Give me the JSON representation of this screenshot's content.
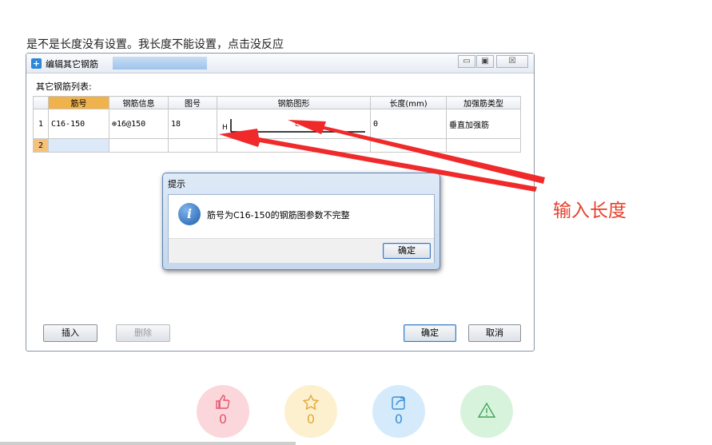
{
  "question": "是不是长度没有设置。我长度不能设置，点击没反应",
  "window": {
    "title": "编辑其它钢筋",
    "controls": {
      "minimize": "▭",
      "maximize": "▣",
      "close": "☒"
    }
  },
  "list_label": "其它钢筋列表:",
  "table": {
    "headers": [
      "筋号",
      "钢筋信息",
      "图号",
      "钢筋图形",
      "长度(mm)",
      "加强筋类型"
    ],
    "rows": [
      {
        "num": "1",
        "cells": [
          "C16-150",
          "⊕16@150",
          "18",
          "",
          "0",
          "垂直加强筋"
        ]
      },
      {
        "num": "2",
        "cells": [
          "",
          "",
          "",
          "",
          "",
          ""
        ]
      }
    ],
    "shape_labels": {
      "h": "H",
      "l": "L"
    }
  },
  "buttons": {
    "insert": "插入",
    "delete": "删除",
    "ok": "确定",
    "cancel": "取消"
  },
  "dialog": {
    "title": "提示",
    "message": "筋号为C16-150的钢筋图参数不完整",
    "ok": "确定",
    "icon": "info-icon"
  },
  "annotation": "输入长度",
  "reactions": [
    {
      "name": "like",
      "icon": "thumbs-up-icon",
      "count": "0",
      "bg": "#fbd7dc",
      "fg": "#e0566b"
    },
    {
      "name": "favorite",
      "icon": "star-icon",
      "count": "0",
      "bg": "#fdf0cf",
      "fg": "#e0a93a"
    },
    {
      "name": "share",
      "icon": "share-icon",
      "count": "0",
      "bg": "#d5ebfb",
      "fg": "#3a8fd6"
    },
    {
      "name": "report",
      "icon": "warning-icon",
      "count": "",
      "bg": "#d8f3dc",
      "fg": "#3fa35a"
    }
  ],
  "colors": {
    "annotation": "#e8402c",
    "arrow": "#f02a2a",
    "header_highlight": "#f0b24c"
  }
}
